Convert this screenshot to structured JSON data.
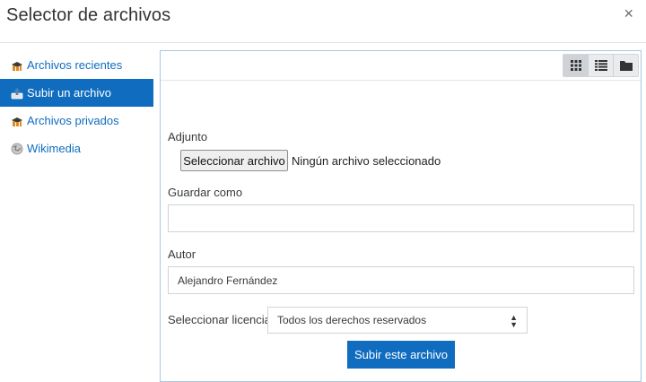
{
  "dialog": {
    "title": "Selector de archivos",
    "close_symbol": "×"
  },
  "sidebar": {
    "items": [
      {
        "label": "Archivos recientes",
        "icon": "recent-files-icon",
        "active": false
      },
      {
        "label": "Subir un archivo",
        "icon": "upload-icon",
        "active": true
      },
      {
        "label": "Archivos privados",
        "icon": "private-files-icon",
        "active": false
      },
      {
        "label": "Wikimedia",
        "icon": "wikimedia-icon",
        "active": false
      }
    ]
  },
  "toolbar": {
    "views": [
      "grid-view-icon",
      "list-view-icon",
      "folder-view-icon"
    ],
    "active_view": "grid-view-icon"
  },
  "form": {
    "attachment_label": "Adjunto",
    "choose_file_label": "Seleccionar archivo",
    "no_file_text": "Ningún archivo seleccionado",
    "save_as_label": "Guardar como",
    "save_as_value": "",
    "author_label": "Autor",
    "author_value": "Alejandro Fernández",
    "license_label": "Seleccionar licencia",
    "license_value": "Todos los derechos reservados",
    "submit_label": "Subir este archivo"
  },
  "colors": {
    "accent": "#0f6cbf",
    "panel_border": "#a7c7df"
  }
}
